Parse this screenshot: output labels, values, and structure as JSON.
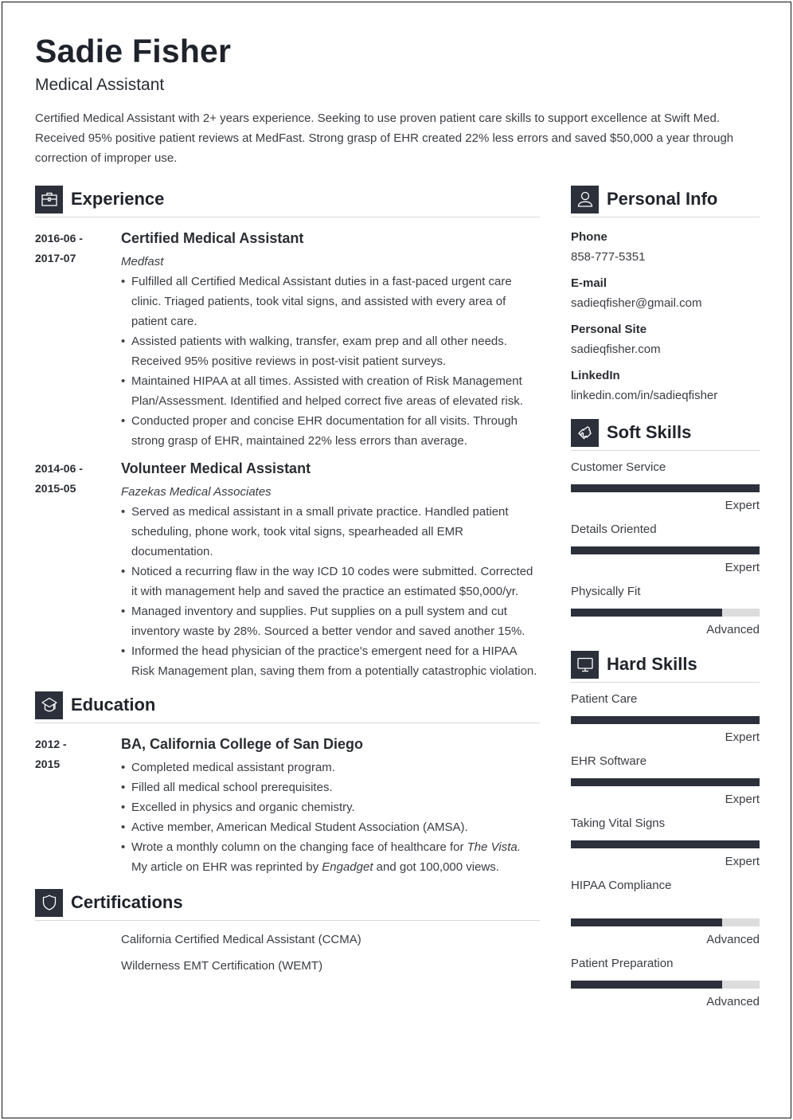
{
  "header": {
    "name": "Sadie Fisher",
    "title": "Medical Assistant",
    "summary": "Certified Medical Assistant with 2+ years experience. Seeking to use proven patient care skills to support excellence at Swift Med. Received 95% positive patient reviews at MedFast. Strong grasp of EHR created 22% less errors and saved $50,000 a year through correction of improper use."
  },
  "colors": {
    "accent": "#2b303b",
    "bar_track": "#dcdcdc",
    "divider": "#d9d9d9"
  },
  "experience": {
    "heading": "Experience",
    "icon": "briefcase-icon",
    "entries": [
      {
        "date_start": "2016-06 -",
        "date_end": "2017-07",
        "role": "Certified Medical Assistant",
        "org": "Medfast",
        "bullets": [
          "Fulfilled all Certified Medical Assistant duties in a fast-paced urgent care clinic. Triaged patients, took vital signs, and assisted with every area of patient care.",
          "Assisted patients with walking, transfer, exam prep and all other needs. Received 95% positive reviews in post-visit patient surveys.",
          "Maintained HIPAA at all times. Assisted with creation of Risk Management Plan/Assessment. Identified and helped correct five areas of elevated risk.",
          "Conducted proper and concise EHR documentation for all visits. Through strong grasp of EHR, maintained 22% less errors than average."
        ]
      },
      {
        "date_start": "2014-06 -",
        "date_end": "2015-05",
        "role": "Volunteer Medical Assistant",
        "org": "Fazekas Medical Associates",
        "bullets": [
          "Served as medical assistant in a small private practice. Handled patient scheduling, phone work, took vital signs, spearheaded all EMR documentation.",
          "Noticed a recurring flaw in the way ICD 10 codes were submitted. Corrected it with management help and saved the practice an estimated $50,000/yr.",
          "Managed inventory and supplies. Put supplies on a pull system and cut inventory waste by 28%. Sourced a better vendor and saved another 15%.",
          "Informed the head physician of the practice's emergent need for a HIPAA Risk Management plan, saving them from a potentially catastrophic violation."
        ]
      }
    ]
  },
  "education": {
    "heading": "Education",
    "icon": "graduation-cap-icon",
    "entries": [
      {
        "date_start": "2012 -",
        "date_end": "2015",
        "degree": "BA, California College of San Diego",
        "bullets": [
          "Completed medical assistant program.",
          "Filled all medical school prerequisites.",
          "Excelled in physics and organic chemistry.",
          "Active member, American Medical Student Association (AMSA)."
        ],
        "last_bullet": {
          "part1": "Wrote a monthly column on the changing face of healthcare for ",
          "italic1": "The Vista.",
          "part2": " My article on EHR was reprinted by ",
          "italic2": "Engadget",
          "part3": " and got 100,000 views."
        }
      }
    ]
  },
  "certifications": {
    "heading": "Certifications",
    "icon": "shield-icon",
    "items": [
      "California Certified Medical Assistant (CCMA)",
      "Wilderness EMT Certification (WEMT)"
    ]
  },
  "personal_info": {
    "heading": "Personal Info",
    "icon": "user-icon",
    "fields": [
      {
        "label": "Phone",
        "value": "858-777-5351"
      },
      {
        "label": "E-mail",
        "value": "sadieqfisher@gmail.com"
      },
      {
        "label": "Personal Site",
        "value": "sadieqfisher.com"
      },
      {
        "label": "LinkedIn",
        "value": "linkedin.com/in/sadieqfisher"
      }
    ]
  },
  "soft_skills": {
    "heading": "Soft Skills",
    "icon": "puzzle-piece-icon",
    "items": [
      {
        "name": "Customer Service",
        "level": "Expert",
        "percent": 100
      },
      {
        "name": "Details Oriented",
        "level": "Expert",
        "percent": 100
      },
      {
        "name": "Physically Fit",
        "level": "Advanced",
        "percent": 80
      }
    ]
  },
  "hard_skills": {
    "heading": "Hard Skills",
    "icon": "monitor-icon",
    "items": [
      {
        "name": "Patient Care",
        "level": "Expert",
        "percent": 100
      },
      {
        "name": "EHR Software",
        "level": "Expert",
        "percent": 100
      },
      {
        "name": "Taking Vital Signs",
        "level": "Expert",
        "percent": 100
      },
      {
        "name": "HIPAA Compliance",
        "level": "Advanced",
        "percent": 80
      },
      {
        "name": "Patient Preparation",
        "level": "Advanced",
        "percent": 80
      }
    ]
  }
}
